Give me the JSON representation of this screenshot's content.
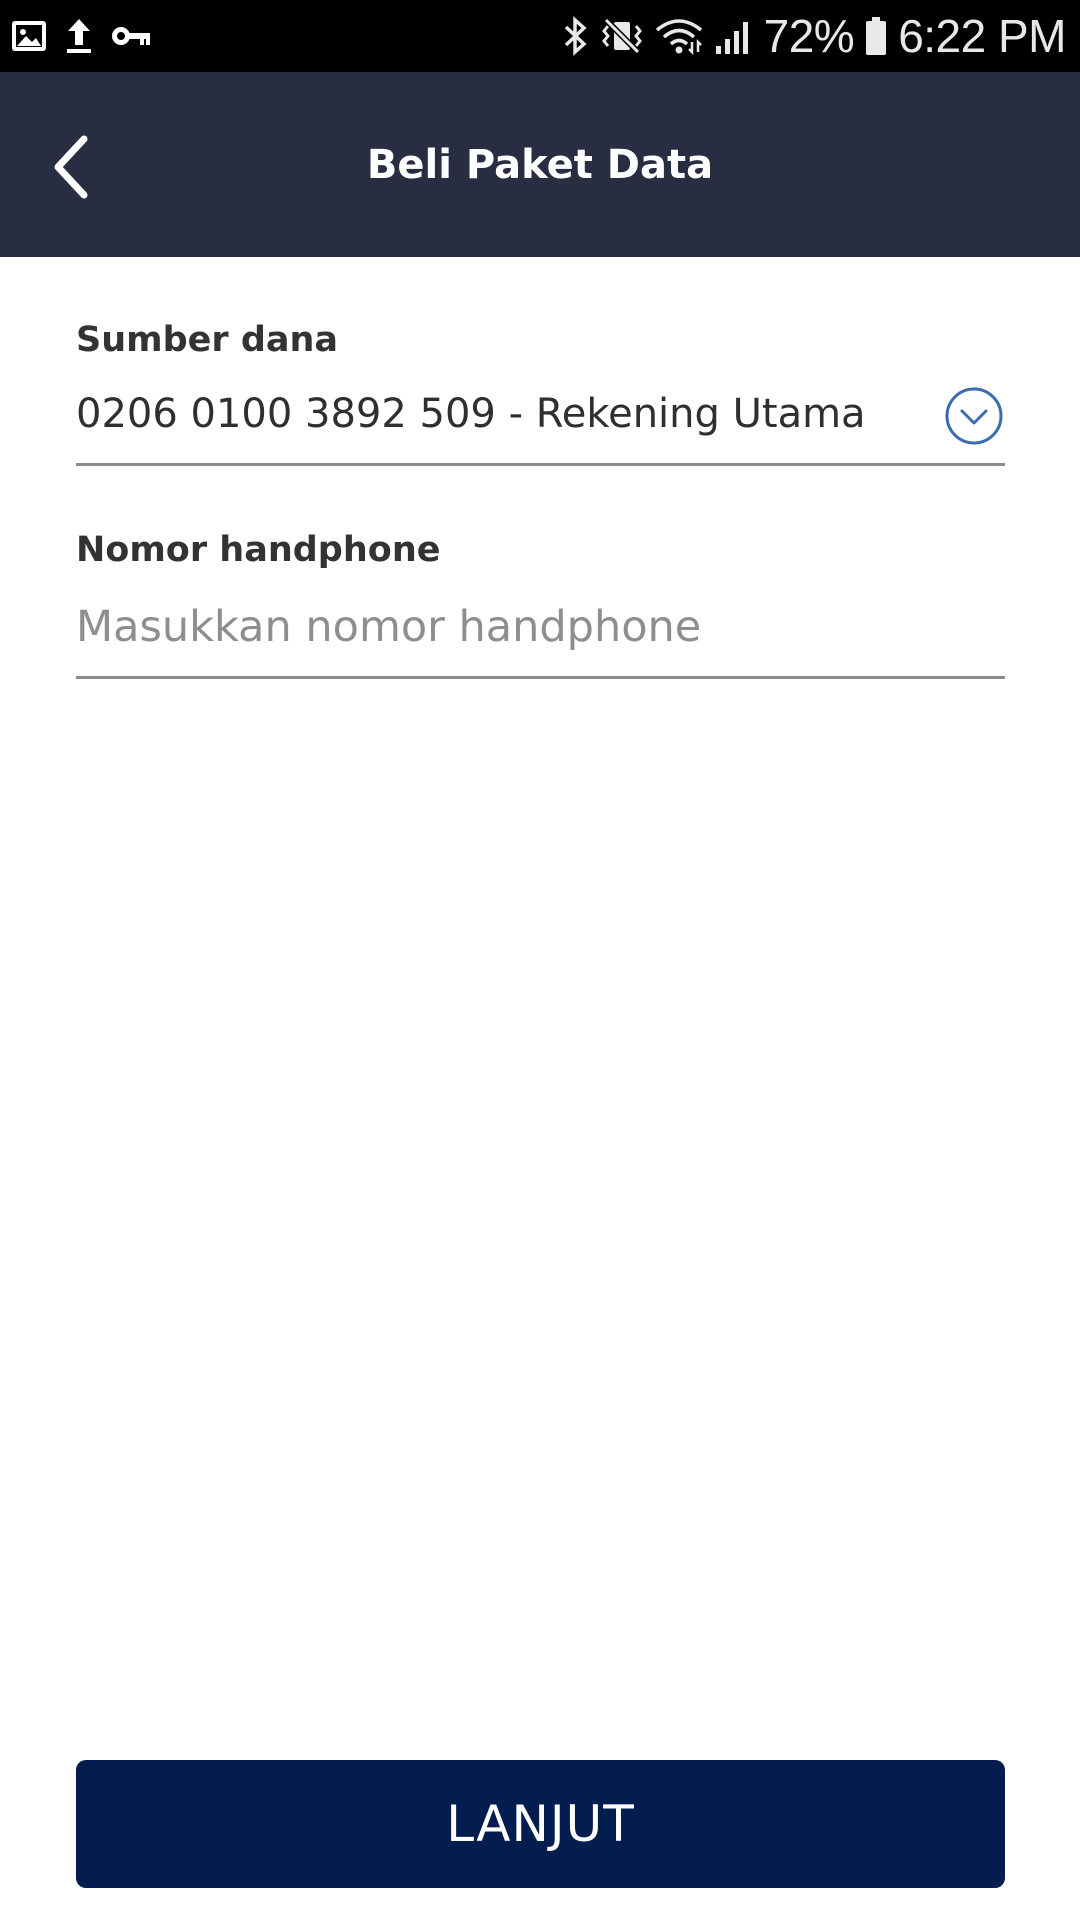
{
  "status_bar": {
    "battery": "72%",
    "time": "6:22 PM",
    "left_icons": [
      "image-icon",
      "upload-icon",
      "key-icon"
    ],
    "right_icons": [
      "bluetooth-icon",
      "vibrate-icon",
      "wifi-icon",
      "signal-icon",
      "battery-icon"
    ]
  },
  "app_bar": {
    "title": "Beli Paket Data",
    "background_color": "#282d41"
  },
  "form": {
    "source_label": "Sumber dana",
    "source_value": "0206 0100 3892 509 - Rekening Utama",
    "phone_label": "Nomor handphone",
    "phone_value": "",
    "phone_placeholder": "Masukkan nomor handphone"
  },
  "actions": {
    "next_label": "LANJUT",
    "button_color": "#031d4e",
    "accent_color": "#3a6db0"
  }
}
